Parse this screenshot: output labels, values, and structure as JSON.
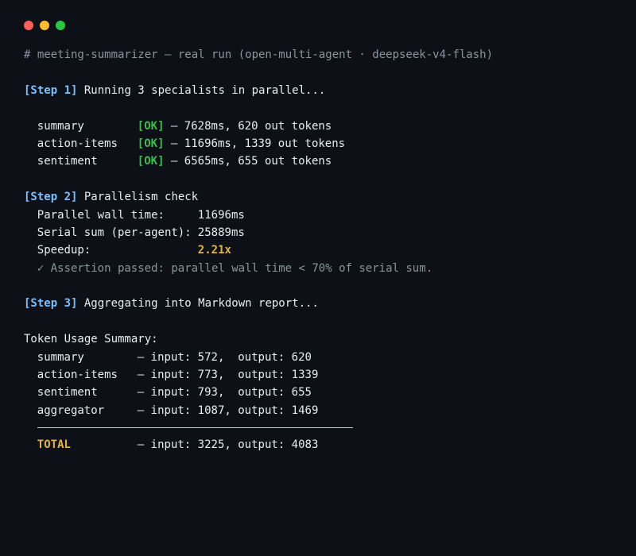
{
  "window": {
    "controls": [
      "close",
      "minimize",
      "maximize"
    ]
  },
  "colors": {
    "background": "#0d1117",
    "text": "#e6edf3",
    "step": "#79c0ff",
    "ok": "#3fb950",
    "highlight": "#e3b341",
    "muted": "#8b949e"
  },
  "header": {
    "comment": "# meeting-summarizer — real run (open-multi-agent · deepseek-v4-flash)"
  },
  "step1": {
    "tag": "[Step 1]",
    "text": " Running 3 specialists in parallel...",
    "agents": [
      {
        "name": "summary",
        "status": "[OK]",
        "detail": " — 7628ms, 620 out tokens"
      },
      {
        "name": "action-items",
        "status": "[OK]",
        "detail": " — 11696ms, 1339 out tokens"
      },
      {
        "name": "sentiment",
        "status": "[OK]",
        "detail": " — 6565ms, 655 out tokens"
      }
    ]
  },
  "step2": {
    "tag": "[Step 2]",
    "text": " Parallelism check",
    "rows": [
      {
        "key": "Parallel wall time:",
        "value": "11696ms"
      },
      {
        "key": "Serial sum (per-agent):",
        "value": "25889ms"
      }
    ],
    "speedup_key": "Speedup:",
    "speedup_value": "2.21x",
    "assertion": "✓ Assertion passed: parallel wall time < 70% of serial sum."
  },
  "step3": {
    "tag": "[Step 3]",
    "text": " Aggregating into Markdown report..."
  },
  "usage": {
    "title": "Token Usage Summary:",
    "rows": [
      {
        "name": "summary",
        "detail": "— input: 572,  output: 620"
      },
      {
        "name": "action-items",
        "detail": "— input: 773,  output: 1339"
      },
      {
        "name": "sentiment",
        "detail": "— input: 793,  output: 655"
      },
      {
        "name": "aggregator",
        "detail": "— input: 1087, output: 1469"
      }
    ],
    "total_label": "TOTAL",
    "total_detail": "— input: 3225, output: 4083"
  }
}
